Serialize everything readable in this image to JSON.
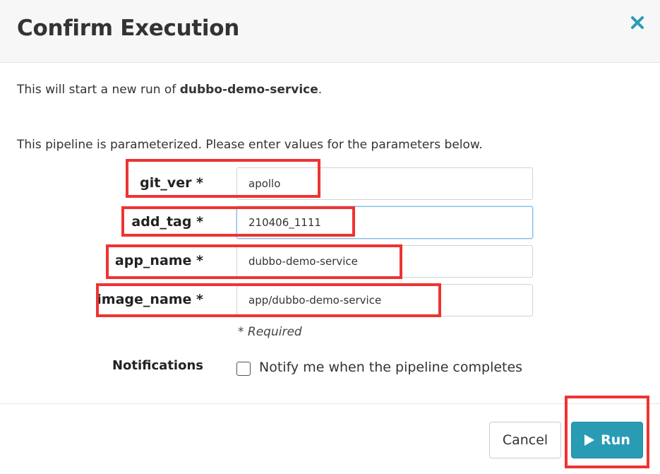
{
  "dialog": {
    "title": "Confirm Execution",
    "close_icon": "close-icon",
    "intro_prefix": "This will start a new run of ",
    "pipeline_name": "dubbo-demo-service",
    "intro_suffix": ".",
    "param_intro": "This pipeline is parameterized. Please enter values for the parameters below."
  },
  "parameters": [
    {
      "label": "git_ver *",
      "value": "apollo"
    },
    {
      "label": "add_tag *",
      "value": "210406_1111"
    },
    {
      "label": "app_name *",
      "value": "dubbo-demo-service"
    },
    {
      "label": "image_name *",
      "value": "app/dubbo-demo-service"
    }
  ],
  "required_note": "* Required",
  "notifications": {
    "label": "Notifications",
    "checkbox_label": "Notify me when the pipeline completes",
    "checked": false
  },
  "footer": {
    "cancel_label": "Cancel",
    "run_label": "Run",
    "run_icon": "play-icon"
  },
  "colors": {
    "accent": "#2a9bb5",
    "annotation": "#ee3333",
    "close_icon": "#2a9bb5"
  }
}
